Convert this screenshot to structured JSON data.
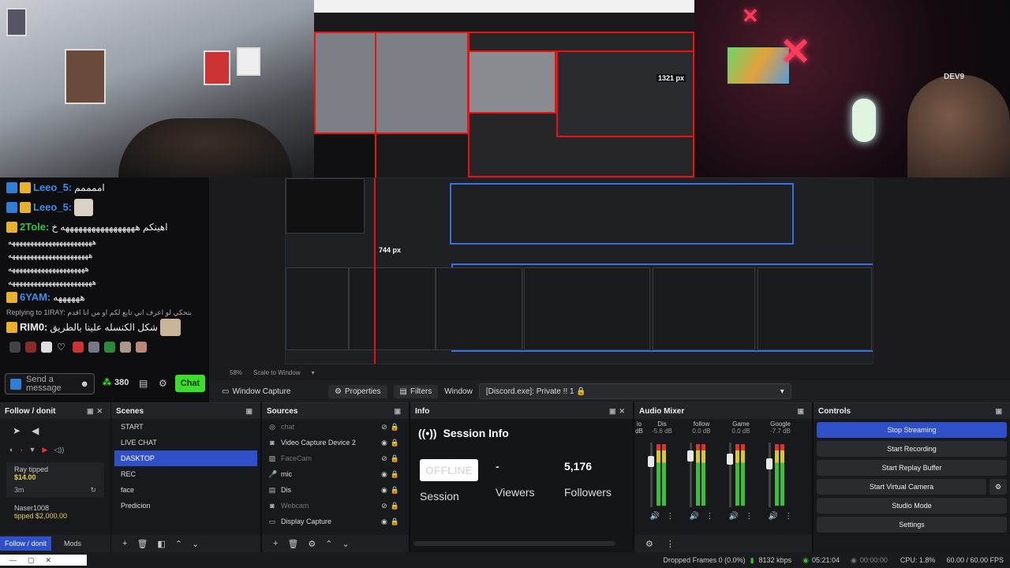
{
  "preview_labels": {
    "px1321": "1321 px",
    "px744": "744 px"
  },
  "cam3": {
    "brand": "DEV9"
  },
  "chat": {
    "messages": [
      {
        "user": "Leeo_5:",
        "text": "اممممم",
        "badges": [
          "blue",
          "gold"
        ]
      },
      {
        "user": "Leeo_5:",
        "text": "",
        "badges": [
          "blue",
          "gold"
        ]
      },
      {
        "user": "2Tole:",
        "text": "اهينكم هههههههههههههههههه خ",
        "badges": [
          "gold"
        ]
      }
    ],
    "long_lines": [
      "هههههههههههههههههههههههه",
      "ههههههههههههههههههههههه",
      "هههههههههههههههههههههه",
      "هههههههههههههههههههههههه"
    ],
    "yam": {
      "user": "6YAM:",
      "text": "ههههههه"
    },
    "reply": "Replying to 1IRAY: بتحكي لو اعرف اني تابع لكم او من انا اقدم",
    "rimo": {
      "user": "RIM0:",
      "text": "شكل الكنسله علينا بالطريق"
    },
    "input_placeholder": "Send a message",
    "points": "380",
    "chat_button": "Chat"
  },
  "preview": {
    "zoom": "58%",
    "scale": "Scale to Window"
  },
  "toolbar": {
    "source_name": "Window Capture",
    "properties": "Properties",
    "filters": "Filters",
    "window_label": "Window",
    "window_value": "[Discord.exe]: Private !! 1 🔒"
  },
  "follow": {
    "title": "Follow / donit",
    "tip1_name": "Ray tipped",
    "tip1_amt": "$14.00",
    "tip1_time": "3m",
    "tip2_name": "Naser1008",
    "tip2_amt": "tipped $2,000.00",
    "tab1": "Follow / donit",
    "tab2": "Mods"
  },
  "scenes": {
    "title": "Scenes",
    "items": [
      "START",
      "LIVE CHAT",
      "DASKTOP",
      "REC",
      "face",
      "Predicion"
    ],
    "selected": 2
  },
  "sources": {
    "title": "Sources",
    "items": [
      {
        "name": "chat",
        "icon": "browser-icon",
        "dim": true
      },
      {
        "name": "Video Capture Device 2",
        "icon": "camera-icon",
        "dim": false
      },
      {
        "name": "FaceCam",
        "icon": "image-icon",
        "dim": true
      },
      {
        "name": "mic",
        "icon": "mic-icon",
        "dim": false
      },
      {
        "name": "Dis",
        "icon": "window-icon",
        "dim": false
      },
      {
        "name": "Webcam",
        "icon": "camera-icon",
        "dim": true
      },
      {
        "name": "Display Capture",
        "icon": "monitor-icon",
        "dim": false
      }
    ]
  },
  "info": {
    "title": "Info",
    "session_title": "Session Info",
    "status": "OFFLINE",
    "session_label": "Session",
    "viewers_value": "-",
    "viewers_label": "Viewers",
    "followers_value": "5,176",
    "followers_label": "Followers"
  },
  "mixer": {
    "title": "Audio Mixer",
    "channels": [
      {
        "name": "Dis",
        "db": "-5.6 dB",
        "level": 0.75
      },
      {
        "name": "follow",
        "db": "0.0 dB",
        "level": 0.85
      },
      {
        "name": "Game",
        "db": "0.0 dB",
        "level": 0.8
      },
      {
        "name": "Google",
        "db": "-7.7 dB",
        "level": 0.7
      }
    ],
    "left_label": "io",
    "left_db": "dB"
  },
  "controls": {
    "title": "Controls",
    "buttons": [
      "Stop Streaming",
      "Start Recording",
      "Start Replay Buffer",
      "Start Virtual Camera",
      "Studio Mode",
      "Settings"
    ]
  },
  "status": {
    "dropped": "Dropped Frames 0 (0.0%)",
    "kbps": "8132 kbps",
    "live": "05:21:04",
    "rec": "00:00:00",
    "cpu": "CPU: 1.8%",
    "fps": "60.00 / 60.00 FPS"
  },
  "colors": {
    "accent": "#2f50c8",
    "chat_green": "#38e02a",
    "bg": "#0e0e10"
  }
}
